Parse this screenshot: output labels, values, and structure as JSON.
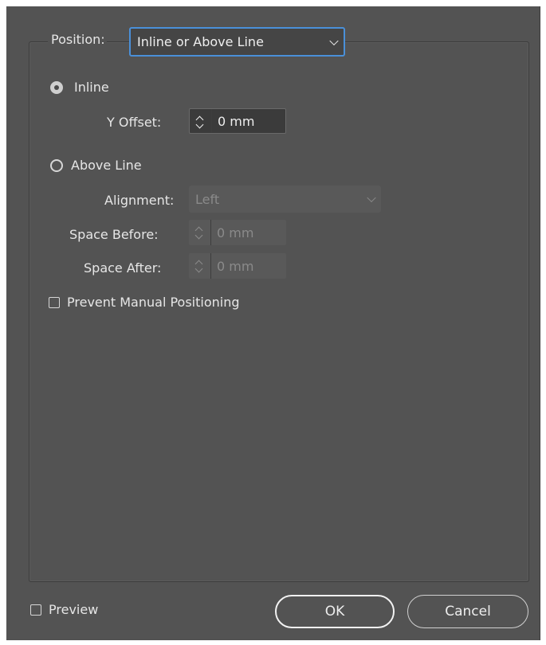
{
  "position": {
    "label": "Position:",
    "value": "Inline or Above Line"
  },
  "inline": {
    "label": "Inline",
    "y_offset_label": "Y Offset:",
    "y_offset_value": "0 mm"
  },
  "above_line": {
    "label": "Above Line",
    "alignment_label": "Alignment:",
    "alignment_value": "Left",
    "space_before_label": "Space Before:",
    "space_before_value": "0 mm",
    "space_after_label": "Space After:",
    "space_after_value": "0 mm"
  },
  "prevent_manual_label": "Prevent Manual Positioning",
  "preview_label": "Preview",
  "ok_label": "OK",
  "cancel_label": "Cancel",
  "state": {
    "inline_selected": true,
    "above_line_selected": false,
    "prevent_manual_checked": false,
    "preview_checked": false
  }
}
